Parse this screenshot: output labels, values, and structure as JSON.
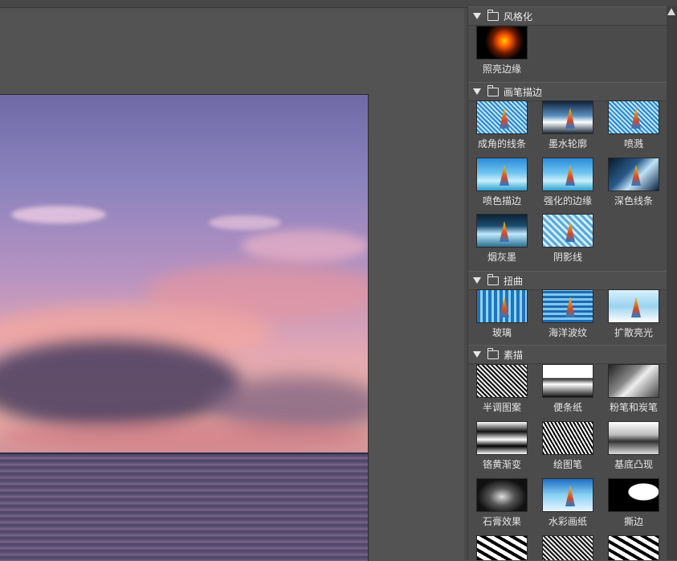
{
  "groups": [
    {
      "title": "风格化",
      "items": [
        {
          "label": "照亮边缘",
          "icon": "glowing-edges-thumbnail"
        }
      ]
    },
    {
      "title": "画笔描边",
      "items": [
        {
          "label": "成角的线条",
          "icon": "angled-strokes-thumbnail"
        },
        {
          "label": "墨水轮廓",
          "icon": "ink-outlines-thumbnail"
        },
        {
          "label": "喷溅",
          "icon": "spatter-thumbnail"
        },
        {
          "label": "喷色描边",
          "icon": "sprayed-strokes-thumbnail"
        },
        {
          "label": "强化的边缘",
          "icon": "accented-edges-thumbnail"
        },
        {
          "label": "深色线条",
          "icon": "dark-strokes-thumbnail"
        },
        {
          "label": "烟灰墨",
          "icon": "sumi-e-thumbnail"
        },
        {
          "label": "阴影线",
          "icon": "crosshatch-thumbnail"
        }
      ]
    },
    {
      "title": "扭曲",
      "items": [
        {
          "label": "玻璃",
          "icon": "glass-thumbnail"
        },
        {
          "label": "海洋波纹",
          "icon": "ocean-ripple-thumbnail"
        },
        {
          "label": "扩散亮光",
          "icon": "diffuse-glow-thumbnail"
        }
      ]
    },
    {
      "title": "素描",
      "items": [
        {
          "label": "半调图案",
          "icon": "halftone-pattern-thumbnail"
        },
        {
          "label": "便条纸",
          "icon": "note-paper-thumbnail"
        },
        {
          "label": "粉笔和炭笔",
          "icon": "chalk-charcoal-thumbnail"
        },
        {
          "label": "铬黄渐变",
          "icon": "chrome-thumbnail"
        },
        {
          "label": "绘图笔",
          "icon": "graphic-pen-thumbnail"
        },
        {
          "label": "基底凸现",
          "icon": "bas-relief-thumbnail"
        },
        {
          "label": "石膏效果",
          "icon": "plaster-thumbnail"
        },
        {
          "label": "水彩画纸",
          "icon": "water-paper-thumbnail"
        },
        {
          "label": "撕边",
          "icon": "torn-edges-thumbnail"
        }
      ]
    }
  ]
}
